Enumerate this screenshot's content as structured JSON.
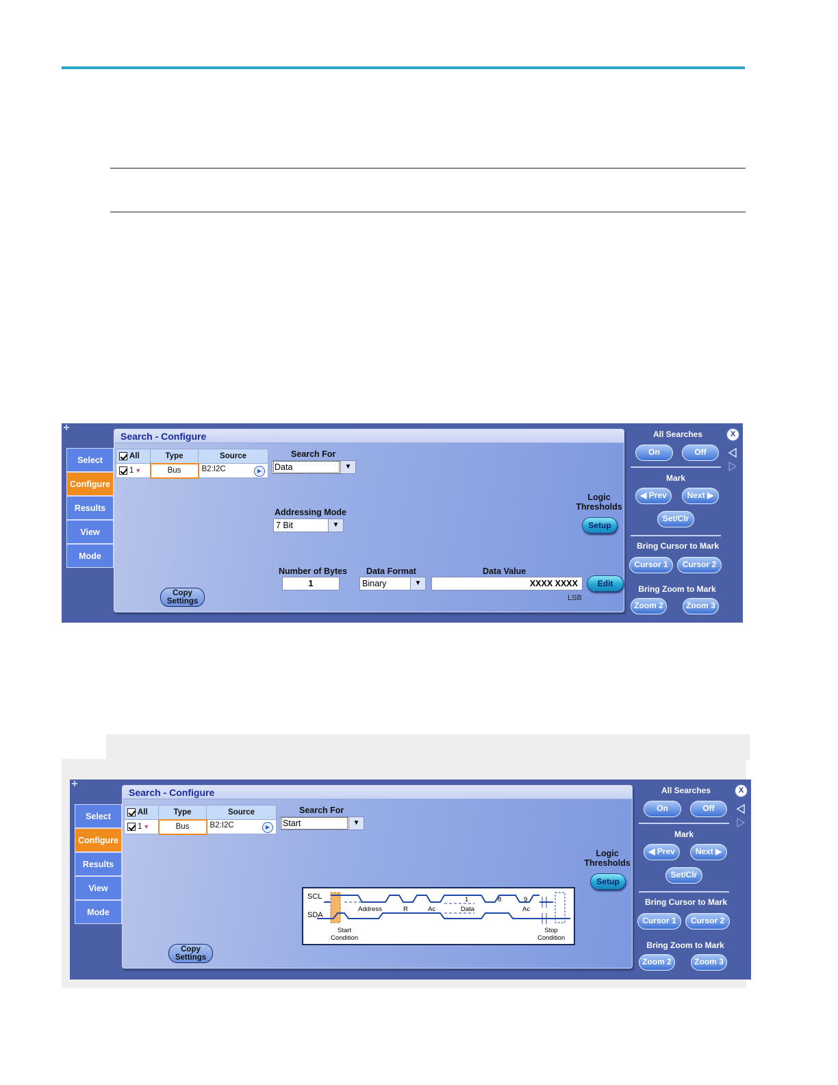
{
  "panel1": {
    "title": "Search - Configure",
    "tabs": [
      "Select",
      "Configure",
      "Results",
      "View",
      "Mode"
    ],
    "table": {
      "headers": [
        "All",
        "Type",
        "Source"
      ],
      "row": {
        "index": "1",
        "type": "Bus",
        "source": "B2:I2C"
      }
    },
    "search_for_label": "Search For",
    "search_for_value": "Data",
    "addressing_mode_label": "Addressing Mode",
    "addressing_mode_value": "7 Bit",
    "logic_thresholds_label": "Logic\nThresholds",
    "setup_label": "Setup",
    "num_bytes_label": "Number of Bytes",
    "num_bytes_value": "1",
    "data_format_label": "Data Format",
    "data_format_value": "Binary",
    "data_value_label": "Data Value",
    "data_value_value": "XXXX XXXX",
    "edit_label": "Edit",
    "lsb_label": "LSB",
    "copy_settings_line1": "Copy",
    "copy_settings_line2": "Settings"
  },
  "panel2": {
    "title": "Search - Configure",
    "tabs": [
      "Select",
      "Configure",
      "Results",
      "View",
      "Mode"
    ],
    "table": {
      "headers": [
        "All",
        "Type",
        "Source"
      ],
      "row": {
        "index": "1",
        "type": "Bus",
        "source": "B2:I2C"
      }
    },
    "search_for_label": "Search For",
    "search_for_value": "Start",
    "logic_thresholds_label": "Logic\nThresholds",
    "setup_label": "Setup",
    "copy_settings_line1": "Copy",
    "copy_settings_line2": "Settings",
    "diagram": {
      "scl": "SCL",
      "sda": "SDA",
      "address": "Address",
      "r": "R",
      "ac1": "Ac",
      "data": "Data",
      "ac2": "Ac",
      "n1": "1",
      "n8": "8",
      "n9": "9",
      "start1": "Start",
      "start2": "Condition",
      "stop1": "Stop",
      "stop2": "Condition"
    }
  },
  "right_panel": {
    "all_searches": "All Searches",
    "on": "On",
    "off": "Off",
    "mark": "Mark",
    "prev": "◀ Prev",
    "next": "Next ▶",
    "setclr": "Set/Clr",
    "bring_cursor": "Bring Cursor to Mark",
    "cursor1": "Cursor 1",
    "cursor2": "Cursor 2",
    "bring_zoom": "Bring Zoom to Mark",
    "zoom2": "Zoom 2",
    "zoom3": "Zoom 3",
    "close": "X"
  },
  "colors": {
    "accent_rule": "#2aa6c6",
    "panel_bg": "#4a5fa6",
    "active_tab": "#f08c1e",
    "tab": "#5c82e6"
  }
}
